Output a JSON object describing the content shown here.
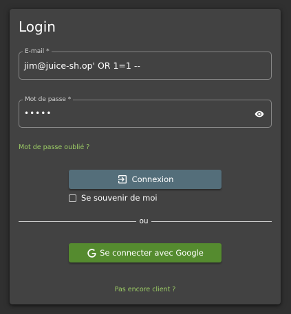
{
  "login": {
    "title": "Login",
    "email": {
      "label": "E-mail *",
      "value": "jim@juice-sh.op' OR 1=1 --"
    },
    "password": {
      "label": "Mot de passe *",
      "masked_value": "•••••",
      "toggle_icon": "eye-icon"
    },
    "forgot_password": "Mot de passe oublié ?",
    "login_button": {
      "label": "Connexion",
      "icon": "login-icon"
    },
    "remember_me": {
      "label": "Se souvenir de moi",
      "checked": false
    },
    "divider_text": "ou",
    "google_button": {
      "label": "Se connecter avec Google",
      "icon": "google-g-icon"
    },
    "register_link": "Pas encore client ?"
  },
  "colors": {
    "background": "#303030",
    "card": "#424242",
    "link": "#9ccc65",
    "login_button": "#546e7a",
    "google_button": "#558b2f"
  }
}
